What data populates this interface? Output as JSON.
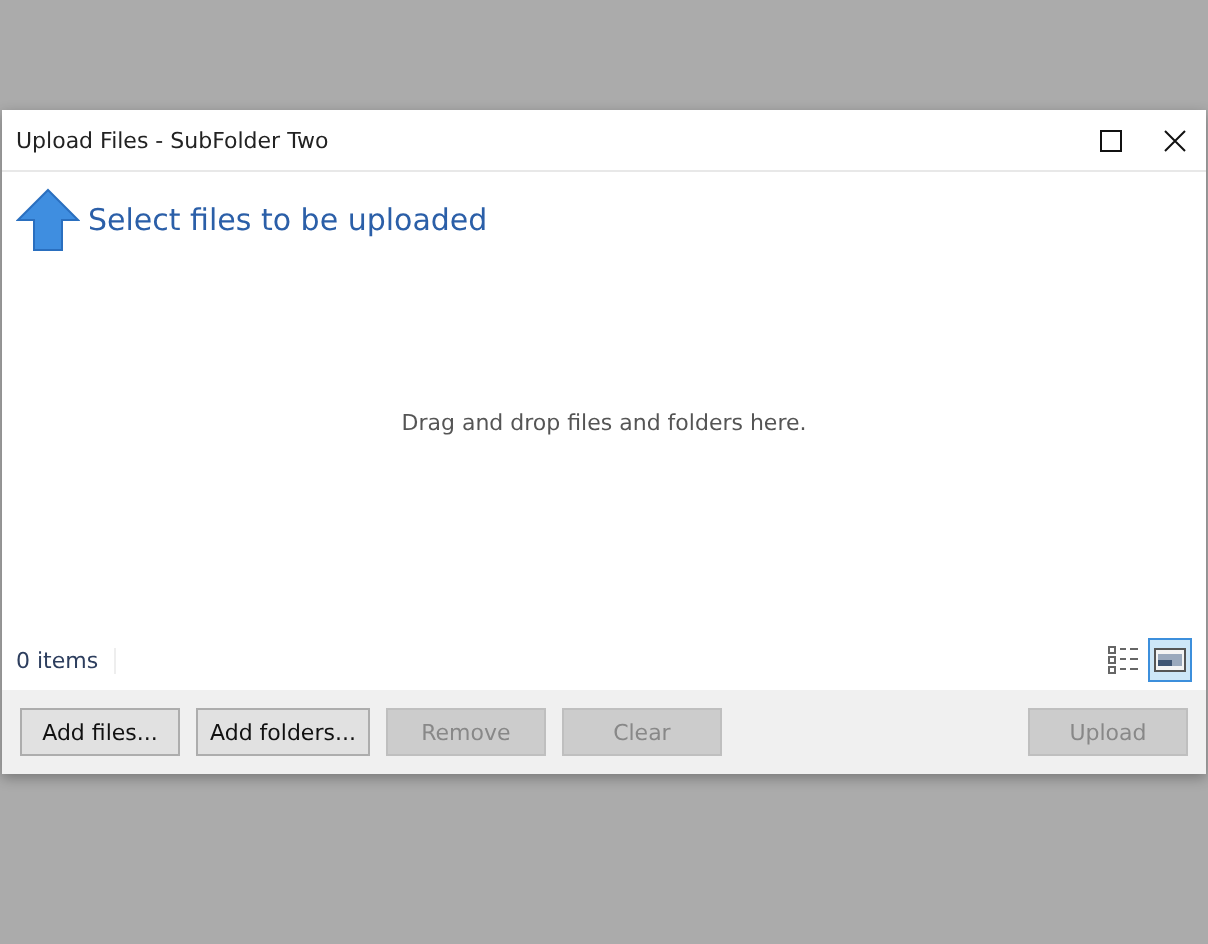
{
  "window": {
    "title": "Upload Files - SubFolder Two"
  },
  "header": {
    "text": "Select files to be uploaded"
  },
  "drop_zone": {
    "hint": "Drag and drop files and folders here."
  },
  "status": {
    "count": "0 items"
  },
  "view_buttons": [
    {
      "kind": "list",
      "selected": false
    },
    {
      "kind": "thumbnails",
      "selected": true
    }
  ],
  "buttons": [
    {
      "label": "Add files...",
      "disabled": false
    },
    {
      "label": "Add folders...",
      "disabled": false
    },
    {
      "label": "Remove",
      "disabled": true
    },
    {
      "label": "Clear",
      "disabled": true
    }
  ],
  "upload_button": {
    "label": "Upload",
    "disabled": true
  }
}
